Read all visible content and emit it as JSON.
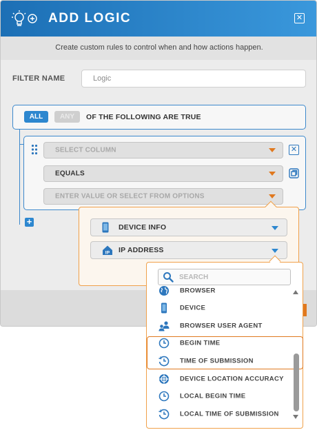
{
  "dialog": {
    "title": "ADD LOGIC",
    "subtitle": "Create custom rules to control when and how actions happen.",
    "close_icon": "close-icon",
    "logo_icon": "lightbulb-gear-icon"
  },
  "filter": {
    "label": "FILTER NAME",
    "placeholder": "Logic",
    "value": ""
  },
  "conditions": {
    "all_label": "ALL",
    "any_label": "ANY",
    "selected": "ALL",
    "text": "OF THE FOLLOWING ARE TRUE"
  },
  "rule": {
    "column_placeholder": "SELECT COLUMN",
    "operator": "EQUALS",
    "value_placeholder": "ENTER VALUE OR SELECT FROM OPTIONS"
  },
  "options": {
    "device_info": "DEVICE INFO",
    "ip_address": "IP ADDRESS"
  },
  "list": {
    "search_placeholder": "SEARCH",
    "items": [
      {
        "label": "BROWSER",
        "icon": "globe-icon"
      },
      {
        "label": "DEVICE",
        "icon": "phone-icon"
      },
      {
        "label": "BROWSER USER AGENT",
        "icon": "users-icon"
      },
      {
        "label": "BEGIN TIME",
        "icon": "clock-icon"
      },
      {
        "label": "TIME OF SUBMISSION",
        "icon": "clock-history-icon"
      },
      {
        "label": "DEVICE LOCATION ACCURACY",
        "icon": "crosshair-icon"
      },
      {
        "label": "LOCAL BEGIN TIME",
        "icon": "clock-icon"
      },
      {
        "label": "LOCAL TIME OF SUBMISSION",
        "icon": "clock-history-icon"
      }
    ],
    "highlighted": [
      "BEGIN TIME",
      "TIME OF SUBMISSION"
    ]
  },
  "colors": {
    "header_blue": "#2a86cf",
    "accent_orange": "#e0781e",
    "icon_blue": "#2d77bd"
  }
}
